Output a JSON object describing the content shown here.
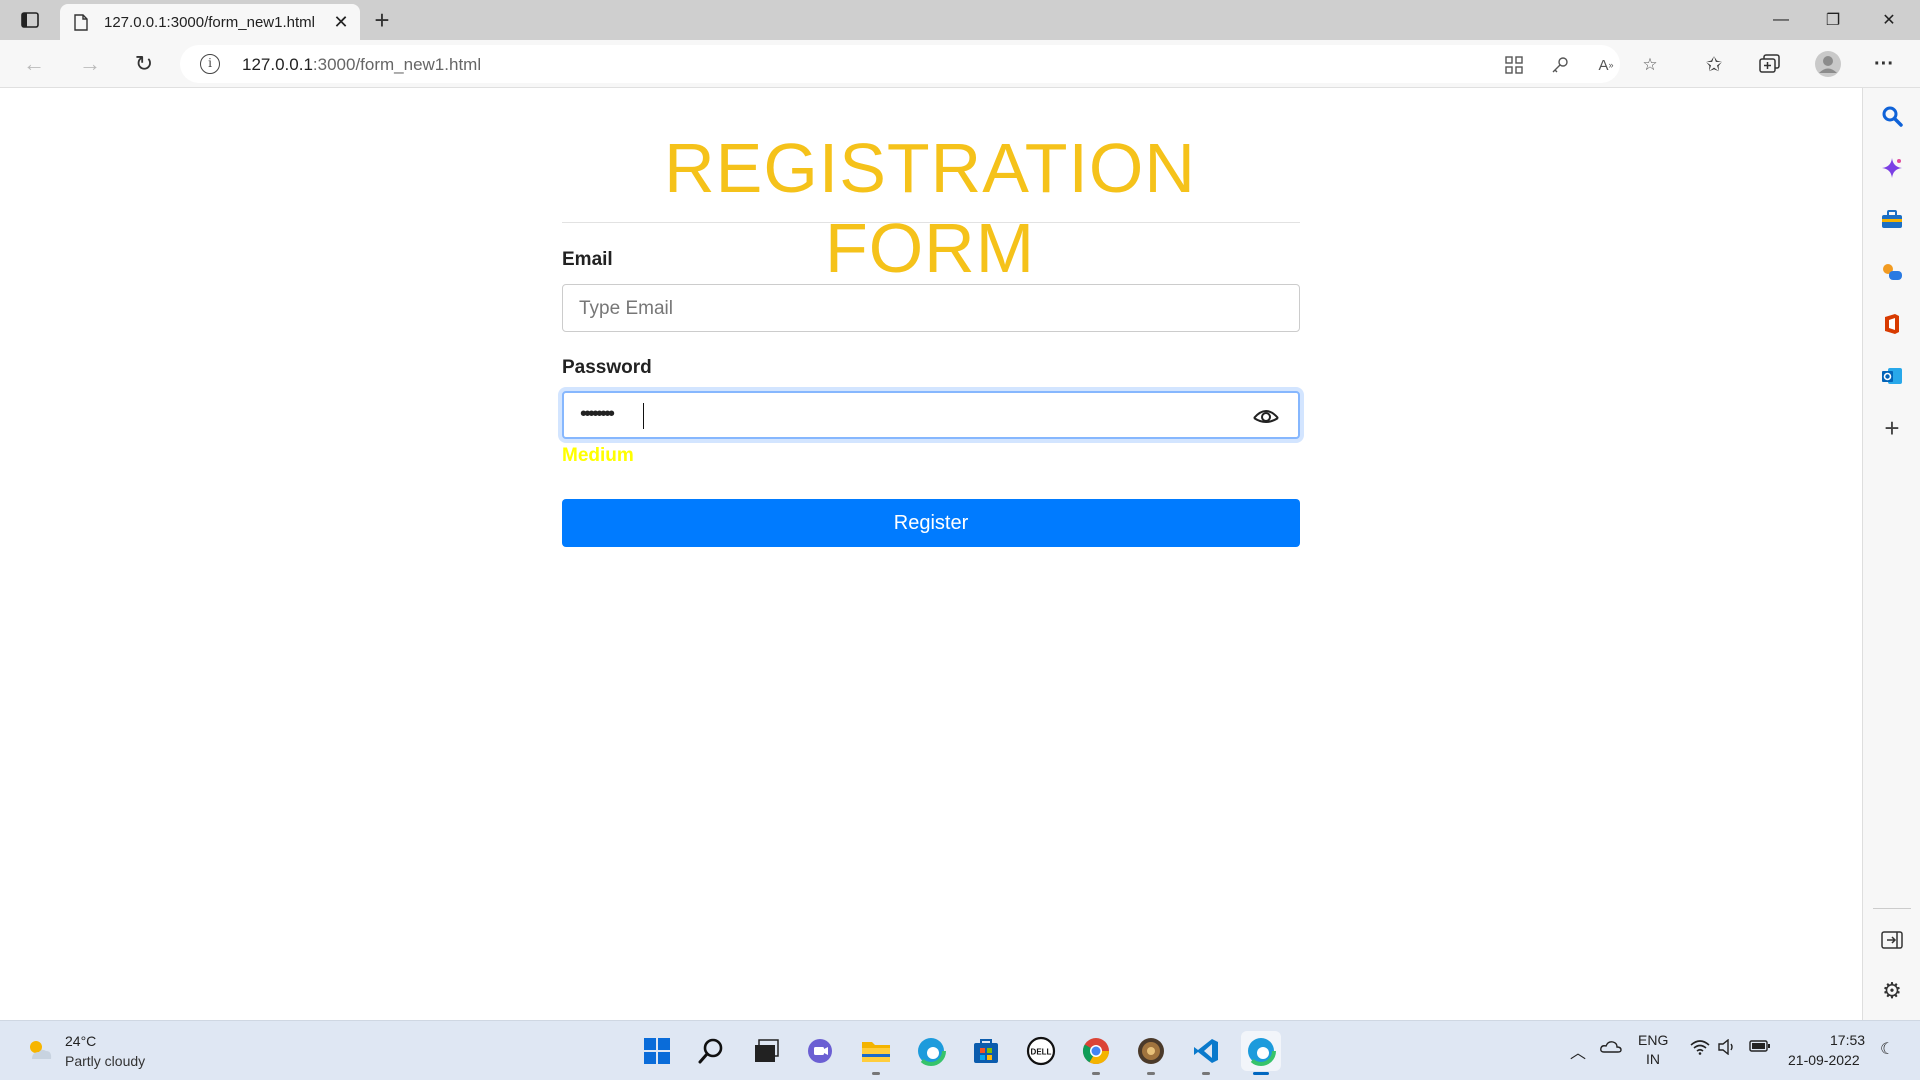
{
  "browser": {
    "tab_title": "127.0.0.1:3000/form_new1.html",
    "tab_close": "✕",
    "new_tab": "+",
    "url_host": "127.0.0.1",
    "url_path": ":3000/form_new1.html",
    "window_controls": {
      "minimize": "—",
      "restore": "❐",
      "close": "✕"
    },
    "nav": {
      "back": "←",
      "forward": "→",
      "reload": "↻"
    },
    "toolbar_icons": [
      "app-available-icon",
      "key-icon",
      "read-aloud-icon",
      "add-favorite-icon",
      "favorites-icon",
      "collections-icon",
      "profile-icon",
      "more-icon"
    ],
    "more_label": "···"
  },
  "sidebar": {
    "icons": [
      "search-icon",
      "copilot-icon",
      "tools-icon",
      "games-icon",
      "office-icon",
      "outlook-icon",
      "add-icon",
      "hide-sidebar-icon",
      "settings-icon"
    ],
    "add_label": "+"
  },
  "form": {
    "title": "REGISTRATION FORM",
    "email_label": "Email",
    "email_placeholder": "Type Email",
    "password_label": "Password",
    "password_value": "••••••••",
    "strength_text": "Medium",
    "register_label": "Register",
    "colors": {
      "title": "#f5c21a",
      "button": "#007bff",
      "strength": "#ffff00"
    }
  },
  "taskbar": {
    "weather_temp": "24°C",
    "weather_desc": "Partly cloudy",
    "apps": [
      "start-icon",
      "search-icon",
      "task-view-icon",
      "teams-chat-icon",
      "file-explorer-icon",
      "edge-icon",
      "store-icon",
      "dell-icon",
      "chrome-icon",
      "game-app-icon",
      "vscode-icon",
      "edge-active-icon"
    ],
    "lang_line1": "ENG",
    "lang_line2": "IN",
    "time": "17:53",
    "date": "21-09-2022"
  }
}
